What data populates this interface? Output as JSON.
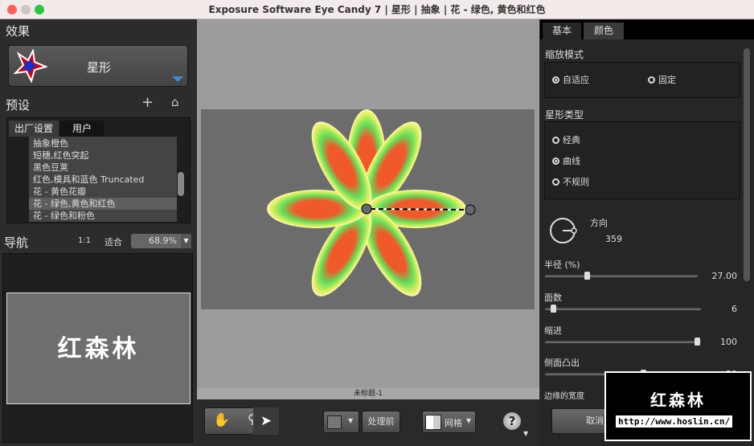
{
  "window": {
    "title": "Exposure Software Eye Candy 7 | 星形 | 抽象 | 花 - 绿色, 黄色和红色"
  },
  "effect": {
    "heading": "效果",
    "name": "星形"
  },
  "presets": {
    "heading": "预设",
    "tabs": [
      "出厂设置",
      "用户"
    ],
    "items": [
      "抽象橙色",
      "短穗,红色突起",
      "黑色豆荚",
      "红色,模具和蓝色 Truncated",
      "花 - 黄色花瓣",
      "花 - 绿色,黄色和红色",
      "花 - 绿色和粉色"
    ],
    "selected_index": 5
  },
  "nav": {
    "heading": "导航",
    "one_to_one": "1:1",
    "fit": "适合",
    "zoom": "68.9%",
    "preview_text": "红森林"
  },
  "canvas": {
    "caption": "未标题-1"
  },
  "toolbar": {
    "before_label": "处理前",
    "grid_label": "网格",
    "help": "?"
  },
  "right": {
    "tabs": [
      "基本",
      "颜色"
    ],
    "scale_mode": {
      "label": "缩放模式",
      "options": [
        "自适应",
        "固定"
      ],
      "selected": 0
    },
    "star_type": {
      "label": "星形类型",
      "options": [
        "经典",
        "曲线",
        "不规则"
      ],
      "selected": 1
    },
    "direction": {
      "label": "方向",
      "value": "359"
    },
    "sliders": [
      {
        "label": "半径 (%)",
        "value": "27.00",
        "fraction": 0.27
      },
      {
        "label": "面数",
        "value": "6",
        "fraction": 0.04
      },
      {
        "label": "缩进",
        "value": "100",
        "fraction": 1.0
      },
      {
        "label": "侧面凸出",
        "value": "29",
        "fraction": 0.64
      }
    ],
    "edge_width_label": "边缘的宽度",
    "cancel": "取消"
  },
  "watermark": {
    "title": "红森林",
    "url": "http://www.hoslin.cn/"
  }
}
